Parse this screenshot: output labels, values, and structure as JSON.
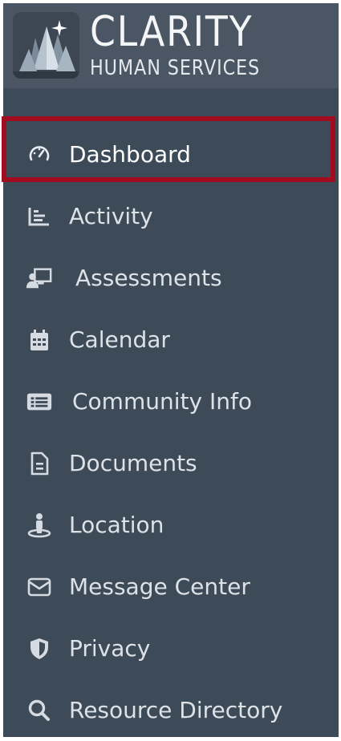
{
  "brand": {
    "title": "CLARITY",
    "subtitle": "HUMAN SERVICES",
    "logo_icon": "crystal-logo-icon"
  },
  "colors": {
    "sidebar_bg": "#3d4a58",
    "header_bg": "#4a5663",
    "highlight_border": "#a10d1e",
    "text": "#dde2e7"
  },
  "nav": {
    "active": "Dashboard",
    "items": [
      {
        "label": "Dashboard",
        "icon": "speedometer-icon"
      },
      {
        "label": "Activity",
        "icon": "chart-bars-icon"
      },
      {
        "label": "Assessments",
        "icon": "presentation-user-icon"
      },
      {
        "label": "Calendar",
        "icon": "calendar-icon"
      },
      {
        "label": "Community Info",
        "icon": "list-card-icon"
      },
      {
        "label": "Documents",
        "icon": "document-icon"
      },
      {
        "label": "Location",
        "icon": "location-person-icon"
      },
      {
        "label": "Message Center",
        "icon": "envelope-icon"
      },
      {
        "label": "Privacy",
        "icon": "shield-icon"
      },
      {
        "label": "Resource Directory",
        "icon": "search-icon"
      }
    ]
  }
}
